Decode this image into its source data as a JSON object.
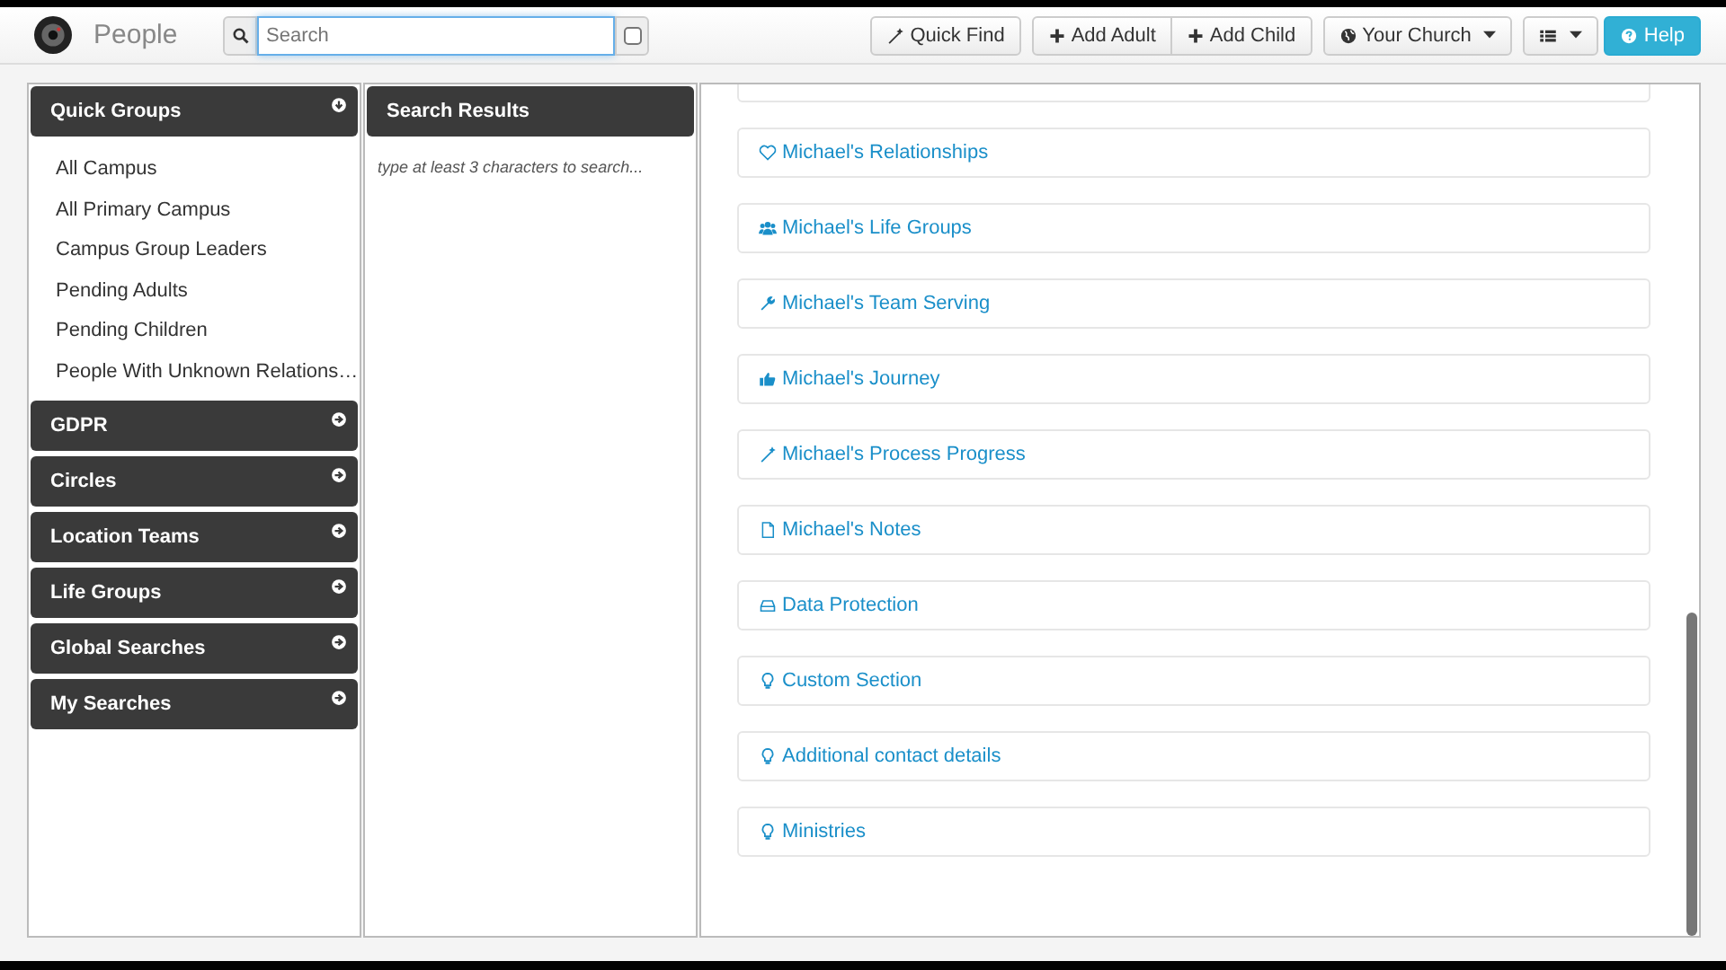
{
  "header": {
    "title": "People",
    "search": {
      "placeholder": "Search",
      "checked": false
    },
    "buttons": [
      {
        "kind": "wand",
        "label": "Quick Find"
      },
      {
        "kind": "plus",
        "label": "Add Adult"
      },
      {
        "kind": "plus",
        "label": "Add Child"
      },
      {
        "kind": "globe",
        "label": "Your Church",
        "dropdown": true
      },
      {
        "kind": "list",
        "dropdown": true
      },
      {
        "kind": "help",
        "label": "Help",
        "primary": true
      }
    ]
  },
  "sidebar": {
    "sections": [
      {
        "title": "Quick Groups",
        "expanded": true,
        "items": [
          "All Campus",
          "All Primary Campus",
          "Campus Group Leaders",
          "Pending Adults",
          "Pending Children",
          "People With Unknown Relations…"
        ]
      },
      {
        "title": "GDPR",
        "expanded": false
      },
      {
        "title": "Circles",
        "expanded": false
      },
      {
        "title": "Location Teams",
        "expanded": false
      },
      {
        "title": "Life Groups",
        "expanded": false
      },
      {
        "title": "Global Searches",
        "expanded": false
      },
      {
        "title": "My Searches",
        "expanded": false
      }
    ]
  },
  "search_results": {
    "title": "Search Results",
    "hint": "type at least 3 characters to search..."
  },
  "sections": [
    "Michael's Relationships",
    "Michael's Life Groups",
    "Michael's Team Serving",
    "Michael's Journey",
    "Michael's Process Progress",
    "Michael's Notes",
    "Data Protection",
    "Custom Section",
    "Additional contact details",
    "Ministries"
  ]
}
